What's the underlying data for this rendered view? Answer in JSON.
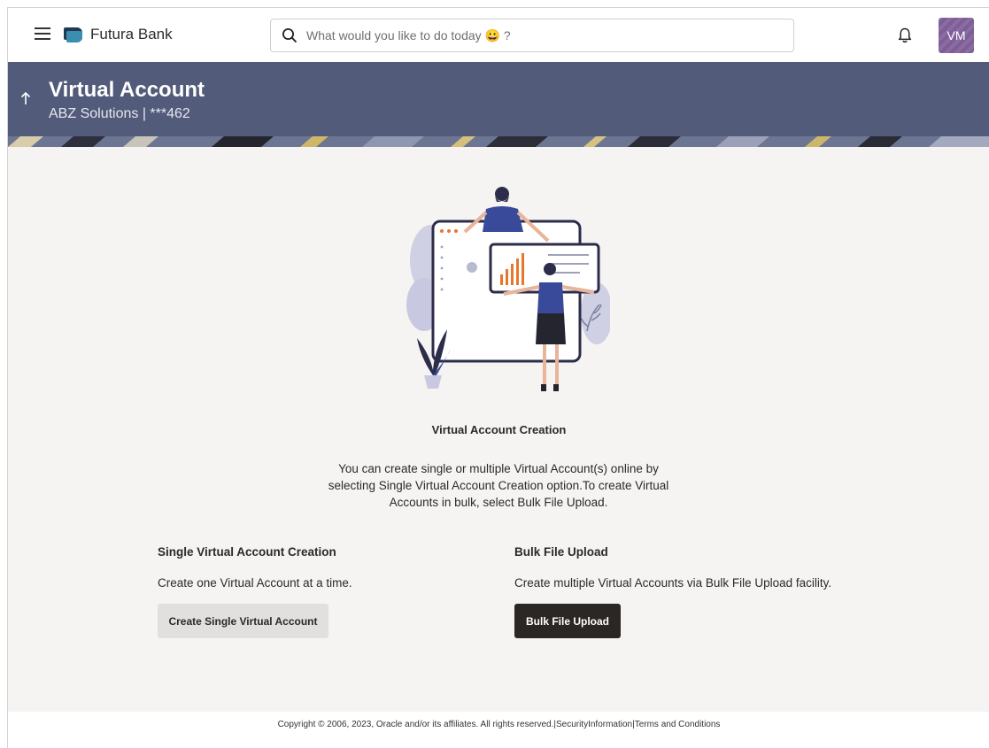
{
  "header": {
    "brand": "Futura Bank",
    "search_placeholder": "What would you like to do today 😀 ?",
    "avatar_initials": "VM"
  },
  "banner": {
    "title": "Virtual Account",
    "subtitle": "ABZ Solutions | ***462"
  },
  "main": {
    "title": "Virtual Account Creation",
    "description": "You can create single or multiple Virtual Account(s) online by selecting Single Virtual Account Creation option.To create Virtual Accounts in bulk, select Bulk File Upload."
  },
  "single": {
    "title": "Single Virtual Account Creation",
    "description": "Create one Virtual Account at a time.",
    "button": "Create Single Virtual Account"
  },
  "bulk": {
    "title": "Bulk File Upload",
    "description": "Create multiple Virtual Accounts via Bulk File Upload facility.",
    "button": "Bulk File Upload"
  },
  "footer": {
    "copyright": "Copyright © 2006, 2023, Oracle and/or its affiliates. All rights reserved.|SecurityInformation|Terms and Conditions"
  },
  "colors": {
    "banner": "#525b7a",
    "page_bg": "#f5f4f2",
    "dark_button": "#2b2724",
    "light_button": "#e1e0de",
    "chart_accent": "#e8772e"
  },
  "icons": [
    "menu-icon",
    "search-icon",
    "bell-icon",
    "back-arrow-icon"
  ]
}
